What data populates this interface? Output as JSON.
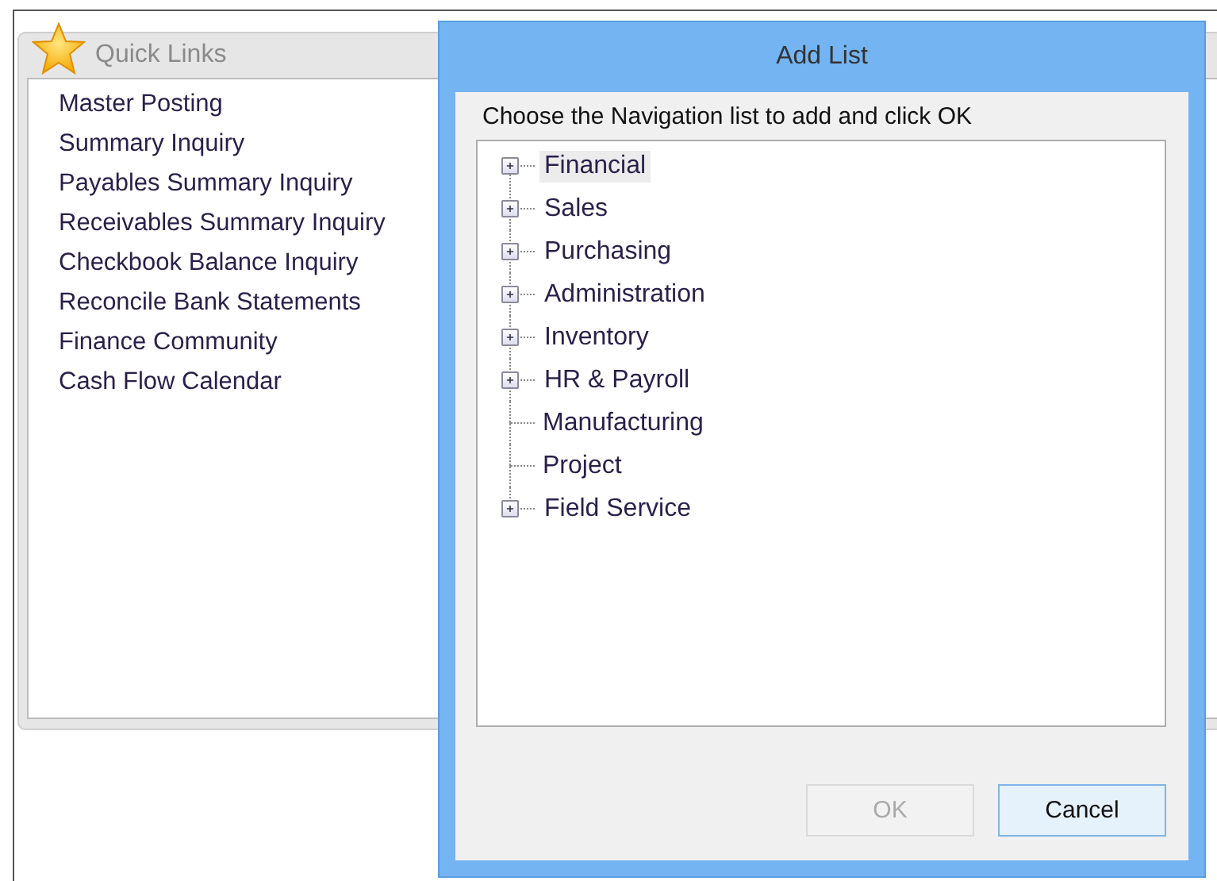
{
  "quick_links": {
    "title": "Quick Links",
    "items": [
      "Master Posting",
      "Summary Inquiry",
      "Payables Summary Inquiry",
      "Receivables Summary Inquiry",
      "Checkbook Balance Inquiry",
      "Reconcile Bank Statements",
      "Finance Community",
      "Cash Flow Calendar"
    ]
  },
  "dialog": {
    "title": "Add List",
    "instruction": "Choose the Navigation list to add and click OK",
    "tree": [
      {
        "label": "Financial",
        "kind": "group",
        "selected": true
      },
      {
        "label": "Sales",
        "kind": "group",
        "selected": false
      },
      {
        "label": "Purchasing",
        "kind": "group",
        "selected": false
      },
      {
        "label": "Administration",
        "kind": "group",
        "selected": false
      },
      {
        "label": "Inventory",
        "kind": "group",
        "selected": false
      },
      {
        "label": "HR & Payroll",
        "kind": "group",
        "selected": false
      },
      {
        "label": "Manufacturing",
        "kind": "leaf",
        "selected": false
      },
      {
        "label": "Project",
        "kind": "leaf",
        "selected": false
      },
      {
        "label": "Field Service",
        "kind": "group",
        "selected": false
      }
    ],
    "buttons": [
      {
        "label": "OK",
        "disabled": true,
        "default": false
      },
      {
        "label": "Cancel",
        "disabled": false,
        "default": true
      }
    ]
  }
}
